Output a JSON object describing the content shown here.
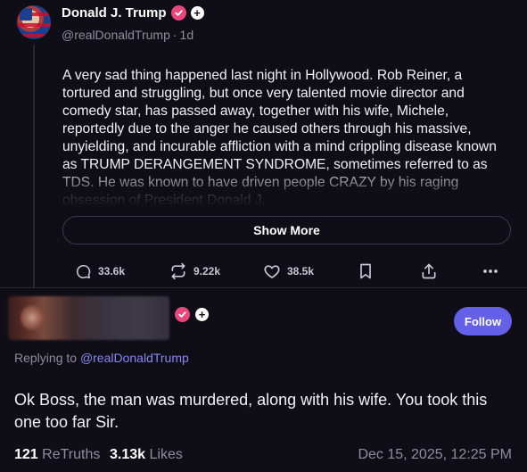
{
  "post": {
    "author_name": "Donald J. Trump",
    "handle": "@realDonaldTrump",
    "separator": "·",
    "age": "1d",
    "verified_badge_color": "#e8467c",
    "text": "A very sad thing happened last night in Hollywood. Rob Reiner, a tortured and struggling, but once very talented movie director and comedy star, has passed away, together with his wife, Michele, reportedly due to the anger he caused others through his massive, unyielding, and incurable affliction with a mind crippling disease known as TRUMP DERANGEMENT SYNDROME, sometimes referred to as TDS. He was known to have driven people CRAZY by his raging obsession of President Donald J.",
    "show_more_label": "Show More",
    "actions": {
      "replies": "33.6k",
      "retruths": "9.22k",
      "likes": "38.5k"
    },
    "icons": [
      "reply-icon",
      "retruth-icon",
      "like-icon",
      "bookmark-icon",
      "share-icon",
      "more-icon"
    ]
  },
  "reply": {
    "follow_label": "Follow",
    "follow_color": "#6461e8",
    "replying_to_prefix": "Replying to",
    "replying_to_handle": "@realDonaldTrump",
    "text": "Ok Boss, the man was murdered, along with his wife.  You took this one too far Sir.",
    "retruths_count": "121",
    "retruths_label": "ReTruths",
    "likes_count": "3.13k",
    "likes_label": "Likes",
    "timestamp": "Dec 15, 2025, 12:25 PM"
  },
  "colors": {
    "background": "#0f0e17",
    "accent": "#8a86f2",
    "muted_text": "#8f8c9d"
  }
}
